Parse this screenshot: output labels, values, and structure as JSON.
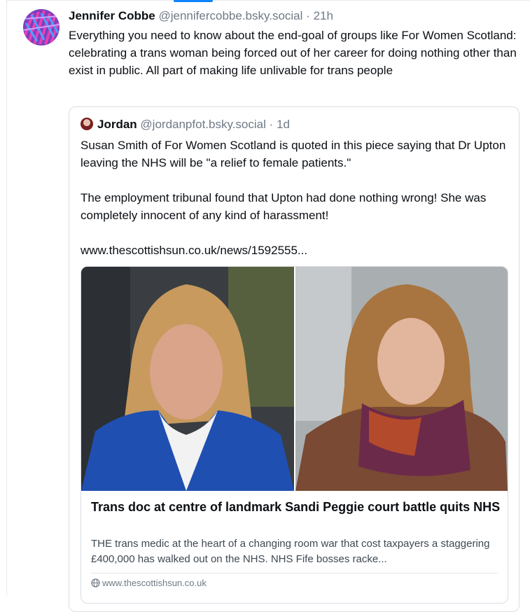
{
  "post": {
    "author_name": "Jennifer Cobbe",
    "author_handle": "@jennifercobbe.bsky.social",
    "separator": "·",
    "time": "21h",
    "text": "Everything you need to know about the end-goal of groups like For Women Scotland: celebrating a trans woman being forced out of her career for doing nothing other than exist in public. All part of making life unlivable for trans people"
  },
  "quote": {
    "author_name": "Jordan",
    "author_handle": "@jordanpfot.bsky.social",
    "separator": "·",
    "time": "1d",
    "paragraphs": [
      "Susan Smith of For Women Scotland is quoted in this piece saying that Dr Upton leaving the NHS will be \"a relief to female patients.\"",
      "The employment tribunal found that Upton had done nothing wrong! She was completely innocent of any kind of harassment!",
      "www.thescottishsun.co.uk/news/1592555..."
    ],
    "card": {
      "title": "Trans doc at centre of landmark Sandi Peggie court battle quits NHS",
      "description": "THE trans medic at the heart of a changing room war that cost taxpayers a staggering £400,000 has walked out on the NHS. NHS Fife bosses racke...",
      "domain": "www.thescottishsun.co.uk"
    }
  },
  "colors": {
    "accent": "#1083fe",
    "muted_text": "#6f7a86",
    "border": "#d9dee4"
  }
}
